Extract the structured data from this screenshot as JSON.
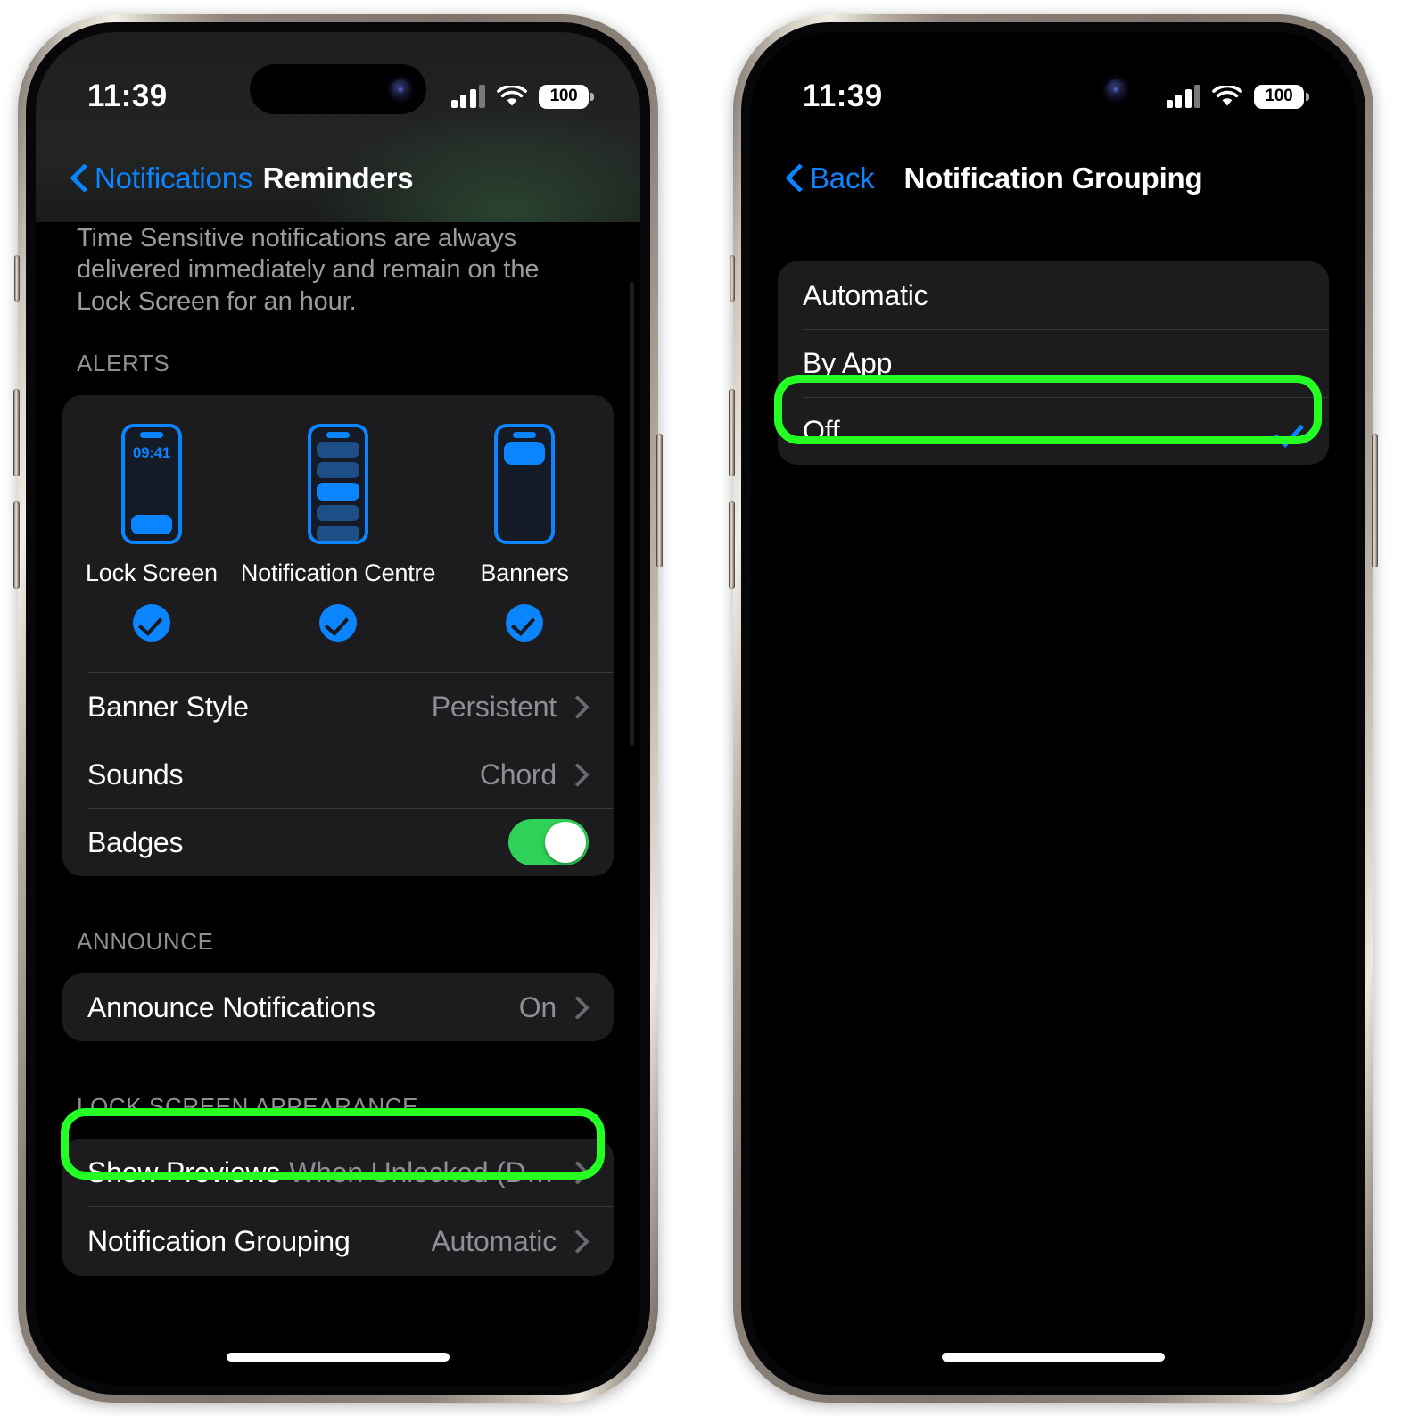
{
  "meta": {
    "platform": "iOS Settings",
    "accent_blue": "#0A84FF",
    "toggle_green": "#30D158",
    "highlight_green": "#24FF24",
    "card_bg": "#1C1C1E",
    "screen_bg": "#000000"
  },
  "status_bar": {
    "time": "11:39",
    "battery_percent": "100",
    "signal_icon": "cellular-bars-icon",
    "wifi_icon": "wifi-icon",
    "battery_icon": "battery-icon"
  },
  "left_phone": {
    "nav": {
      "back_label": "Notifications",
      "back_icon": "chevron-left-icon",
      "title": "Reminders"
    },
    "footnote": "Time Sensitive notifications are always delivered immediately and remain on the Lock Screen for an hour.",
    "alerts_section": {
      "header": "ALERTS",
      "options": [
        {
          "label": "Lock Screen",
          "icon": "lock-screen-phone-icon",
          "time_preview": "09:41",
          "checked": true
        },
        {
          "label": "Notification Centre",
          "icon": "notification-centre-phone-icon",
          "checked": true
        },
        {
          "label": "Banners",
          "icon": "banners-phone-icon",
          "checked": true
        }
      ],
      "rows": [
        {
          "label": "Banner Style",
          "value": "Persistent",
          "accessory": "chevron-right-icon"
        },
        {
          "label": "Sounds",
          "value": "Chord",
          "accessory": "chevron-right-icon"
        },
        {
          "label": "Badges",
          "value": "",
          "accessory": "toggle-on"
        }
      ]
    },
    "announce_section": {
      "header": "ANNOUNCE",
      "rows": [
        {
          "label": "Announce Notifications",
          "value": "On",
          "accessory": "chevron-right-icon"
        }
      ]
    },
    "lock_screen_section": {
      "header": "LOCK SCREEN APPEARANCE",
      "rows": [
        {
          "label": "Show Previews",
          "value": "When Unlocked (Defau…",
          "accessory": "chevron-right-icon"
        },
        {
          "label": "Notification Grouping",
          "value": "Automatic",
          "accessory": "chevron-right-icon",
          "highlighted": true
        }
      ]
    }
  },
  "right_phone": {
    "nav": {
      "back_label": "Back",
      "back_icon": "chevron-left-icon",
      "title": "Notification Grouping"
    },
    "options": [
      {
        "label": "Automatic",
        "selected": false
      },
      {
        "label": "By App",
        "selected": false
      },
      {
        "label": "Off",
        "selected": true,
        "highlighted": true,
        "check_icon": "checkmark-icon"
      }
    ]
  }
}
